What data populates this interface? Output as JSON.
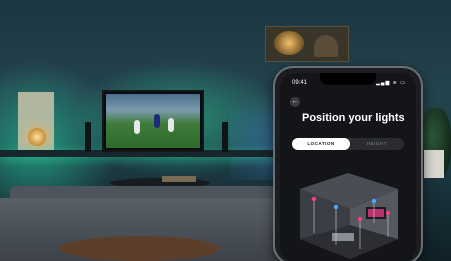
{
  "phone": {
    "time": "09:41",
    "status_icons": "▂▄▆ ≋ ▭",
    "back_icon": "back-arrow-icon",
    "title": "Position your lights",
    "tabs": [
      {
        "label": "LOCATION",
        "active": true
      },
      {
        "label": "HEIGHT",
        "active": false
      }
    ]
  },
  "colors": {
    "accent_tab_bg": "#ffffff",
    "screen_bg": "#141519",
    "ambient_green": "#28dcaa",
    "marker_pink": "#ff3a8c",
    "marker_blue": "#4aa8ff"
  }
}
